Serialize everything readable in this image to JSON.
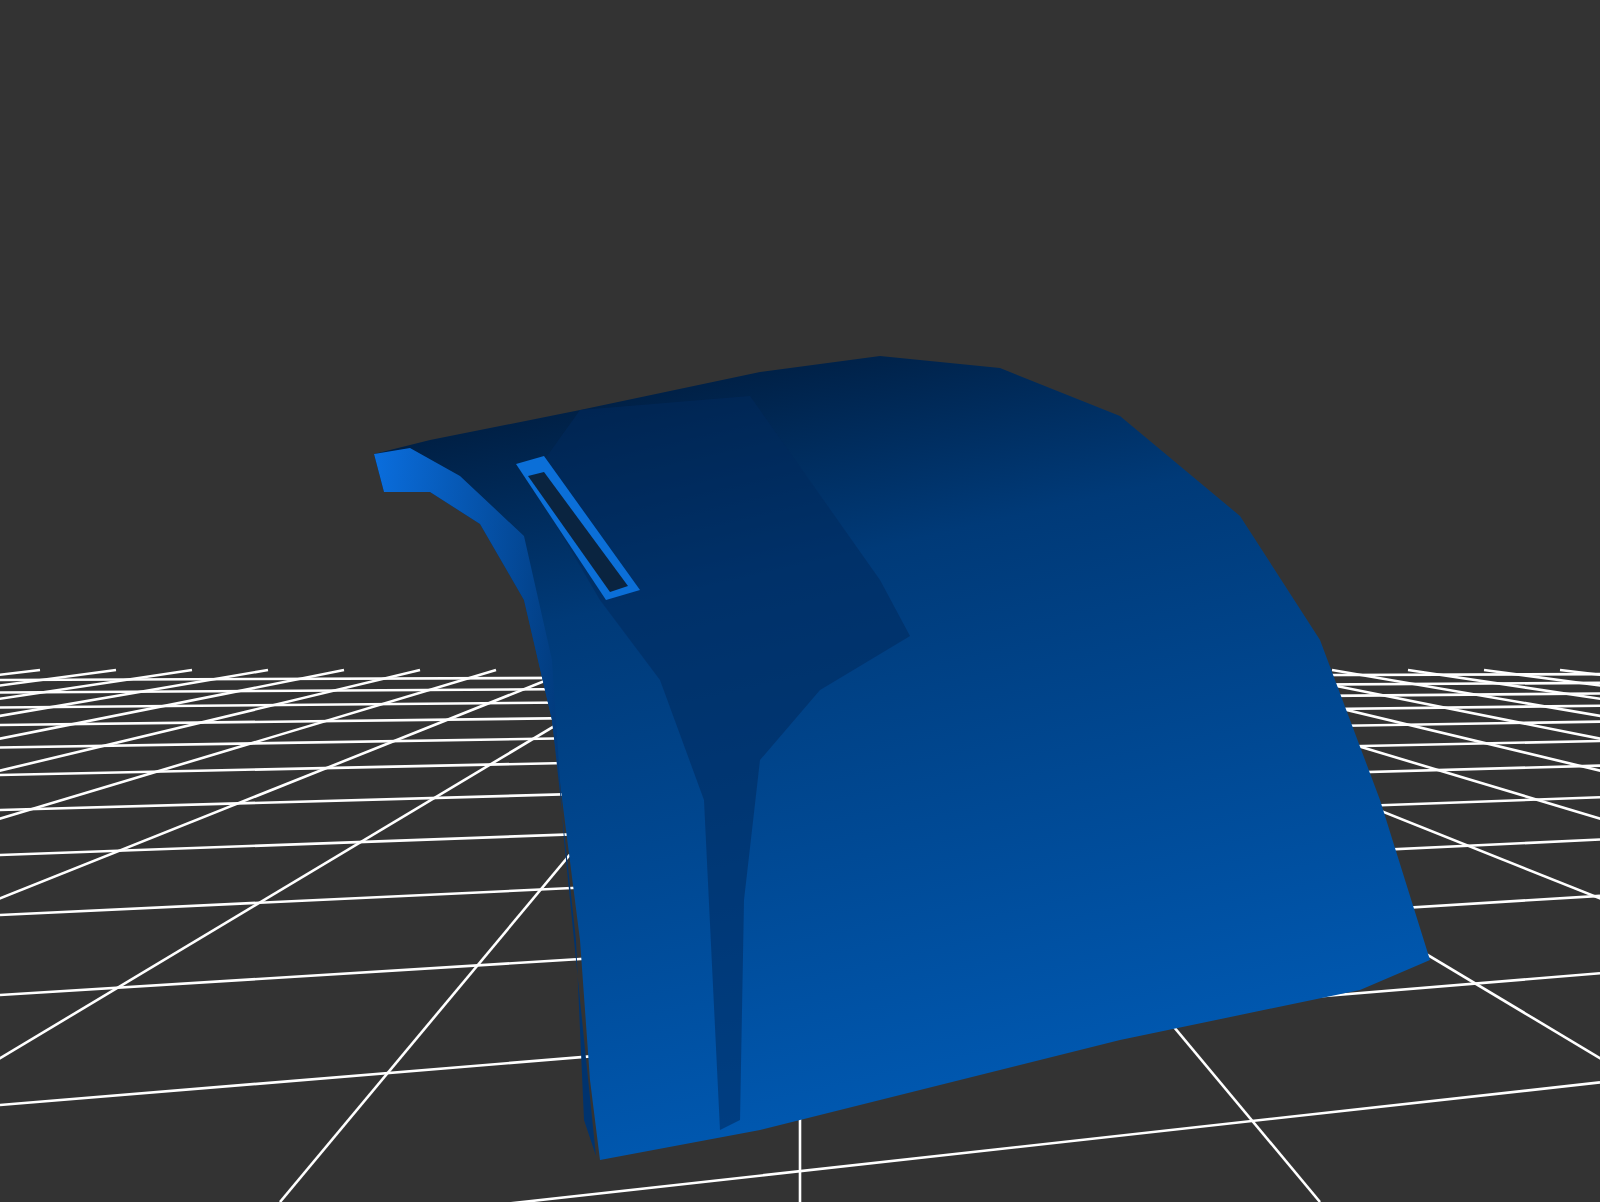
{
  "viewport": {
    "grid": true,
    "model": true
  }
}
